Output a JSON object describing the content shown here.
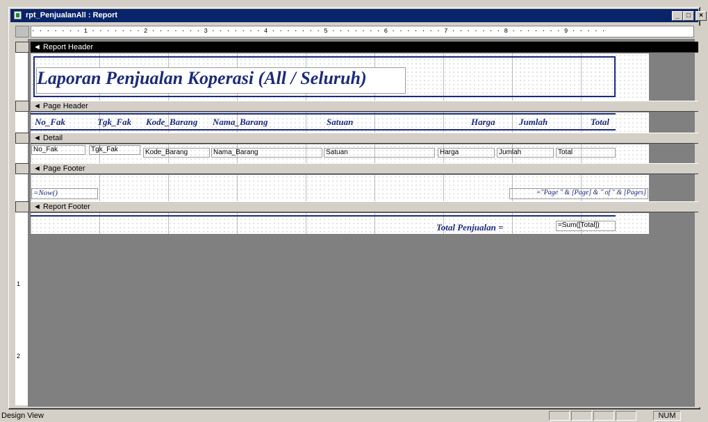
{
  "window": {
    "title": "rpt_PenjualanAll : Report",
    "min": "_",
    "max": "□",
    "close": "×"
  },
  "ruler": {
    "text": "· · · · · · · 1 · · · · · · · 2 · · · · · · · 3 · · · · · · · 4 · · · · · · · 5 · · · · · · · 6 · · · · · · · 7 · · · · · · · 8 · · · · · · · 9 · · · · ·",
    "v1": "1",
    "v2": "2"
  },
  "sections": {
    "report_header": "Report Header",
    "page_header": "Page Header",
    "detail": "Detail",
    "page_footer": "Page Footer",
    "report_footer": "Report Footer"
  },
  "report_title": "Laporan Penjualan Koperasi (All / Seluruh)",
  "page_header_labels": [
    "No_Fak",
    "Tgk_Fak",
    "Kode_Barang",
    "Nama_Barang",
    "Satuan",
    "Harga",
    "Jumlah",
    "Total"
  ],
  "detail_fields": [
    "No_Fak",
    "Tgk_Fak",
    "Kode_Barang",
    "Nama_Barang",
    "Satuan",
    "Harga",
    "Jumlah",
    "Total"
  ],
  "page_footer": {
    "now": "=Now()",
    "page": "=\"Page \" & [Page] & \" of \" & [Pages]"
  },
  "report_footer": {
    "label": "Total Penjualan =",
    "sum": "=Sum([Total])"
  },
  "statusbar": {
    "view": "Design View",
    "num": "NUM"
  },
  "colors": {
    "title_bar": "#0a246a",
    "label_text": "#1b2a7d",
    "background": "#808080"
  }
}
